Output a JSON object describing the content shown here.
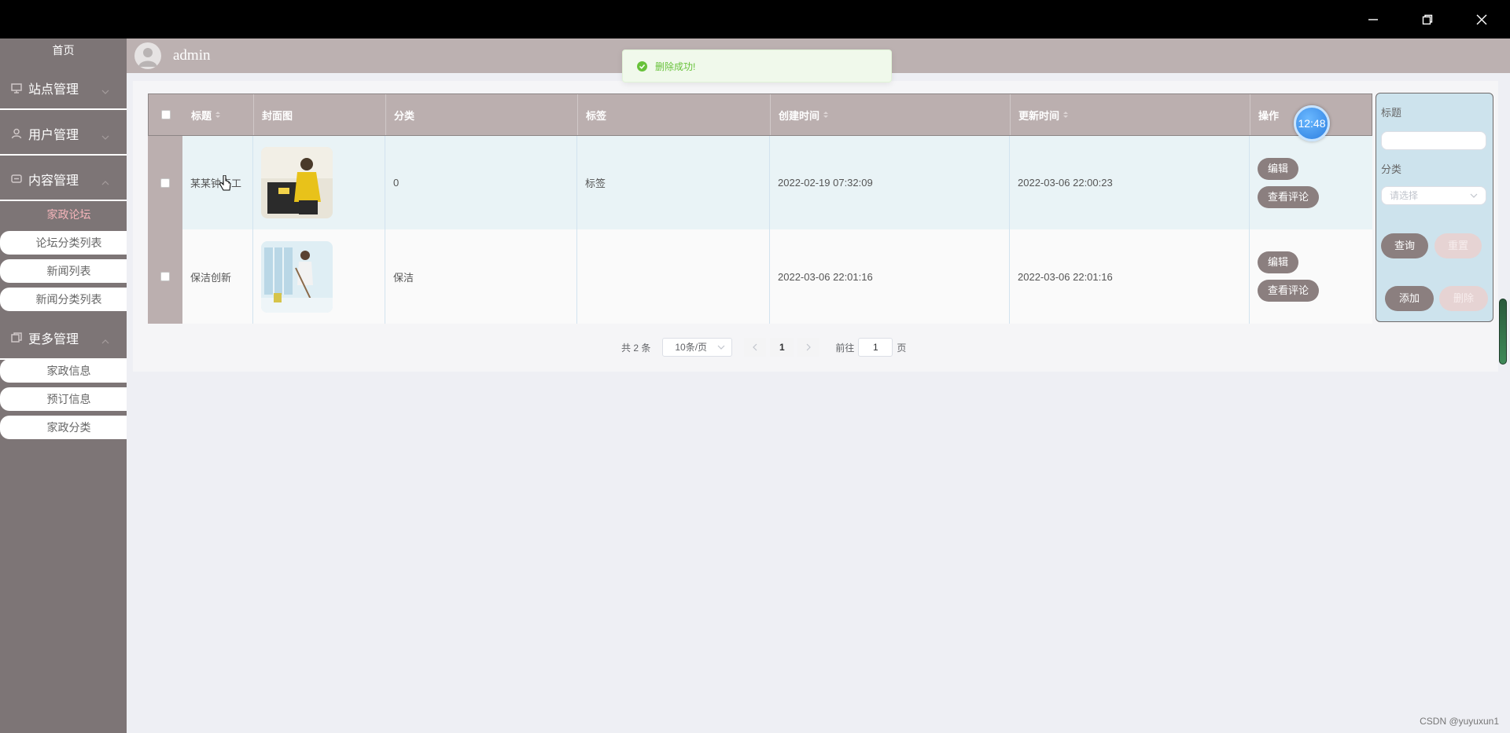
{
  "sidebar": {
    "home": "首页",
    "groups": {
      "site": "站点管理",
      "user": "用户管理",
      "content": "内容管理",
      "more": "更多管理"
    },
    "content_active": "家政论坛",
    "content_items": [
      "论坛分类列表",
      "新闻列表",
      "新闻分类列表"
    ],
    "more_items": [
      "家政信息",
      "预订信息",
      "家政分类"
    ]
  },
  "header": {
    "username": "admin"
  },
  "toast": {
    "message": "删除成功!"
  },
  "timer": {
    "text": "12:48"
  },
  "table": {
    "columns": {
      "title": "标题",
      "cover": "封面图",
      "category": "分类",
      "tags": "标签",
      "created": "创建时间",
      "updated": "更新时间",
      "actions": "操作"
    },
    "rows": [
      {
        "title": "某某钟点工",
        "category": "0",
        "tags": "标签",
        "created": "2022-02-19 07:32:09",
        "updated": "2022-03-06 22:00:23",
        "cover_icon": "cleaning-photo-icon"
      },
      {
        "title": "保洁创新",
        "category": "保洁",
        "tags": "",
        "created": "2022-03-06 22:01:16",
        "updated": "2022-03-06 22:01:16",
        "cover_icon": "mopping-photo-icon"
      }
    ],
    "edit_label": "编辑",
    "view_comments_label": "查看评论"
  },
  "filter": {
    "title_label": "标题",
    "title_value": "",
    "category_label": "分类",
    "category_placeholder": "请选择",
    "query_label": "查询",
    "reset_label": "重置",
    "add_label": "添加",
    "delete_label": "删除"
  },
  "pagination": {
    "total": "共 2 条",
    "page_size": "10条/页",
    "current_page": "1",
    "goto_prefix": "前往",
    "goto_value": "1",
    "goto_suffix": "页"
  },
  "watermark": "CSDN @yuyuxun1",
  "colors": {
    "sidebar_bg": "#7d7576",
    "header_bg": "#bcb1b1",
    "table_head_bg": "#bbafaf",
    "button_bg": "#8b7f7f",
    "filter_bg": "#cde3ed",
    "toast_green": "#67c23a",
    "active_link": "#f5b5ba"
  }
}
